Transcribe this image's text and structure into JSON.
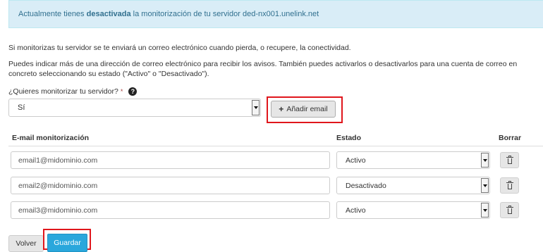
{
  "alert": {
    "prefix": "Actualmente tienes ",
    "status": "desactivada",
    "suffix": " la monitorización de tu servidor ded-nx001.unelink.net"
  },
  "info_text": "Si monitorizas tu servidor se te enviará un correo electrónico cuando pierda, o recupere, la conectividad.",
  "help_text": "Puedes indicar más de una dirección de correo electrónico para recibir los avisos. También puedes activarlos o desactivarlos para una cuenta de correo en concreto seleccionando su estado (\"Activo\" o \"Desactivado\").",
  "monitor_question": {
    "label": "¿Quieres monitorizar tu servidor?",
    "required_mark": "*",
    "help_icon": "question-circle-icon",
    "selected": "Sí"
  },
  "add_email_button": {
    "icon": "plus-icon",
    "label": "Añadir email"
  },
  "table": {
    "headers": {
      "email": "E-mail monitorización",
      "state": "Estado",
      "delete": "Borrar"
    },
    "rows": [
      {
        "email": "email1@midominio.com",
        "state": "Activo"
      },
      {
        "email": "email2@midominio.com",
        "state": "Desactivado"
      },
      {
        "email": "email3@midominio.com",
        "state": "Activo"
      }
    ],
    "delete_icon": "trash-icon"
  },
  "footer": {
    "back_label": "Volver",
    "save_label": "Guardar"
  },
  "colors": {
    "alert_bg": "#d9edf7",
    "alert_text": "#31708f",
    "highlight": "#e0161c",
    "primary": "#2aa7dc"
  }
}
